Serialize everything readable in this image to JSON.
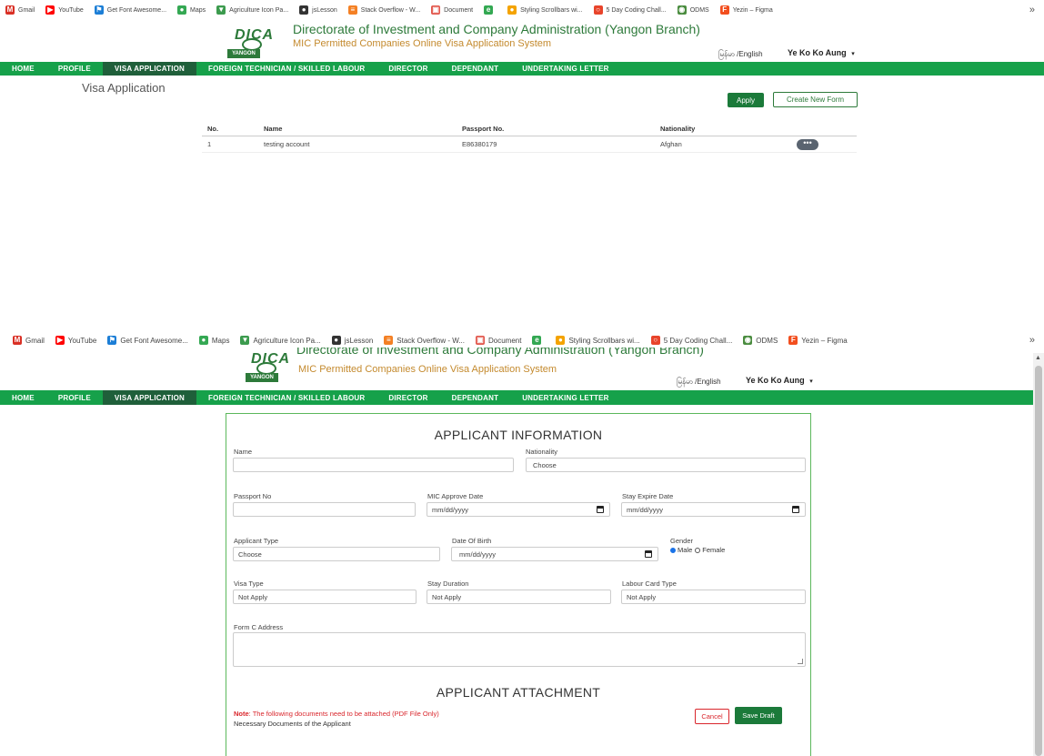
{
  "bookmarks": [
    {
      "label": "Gmail",
      "icon": "gmail-icon",
      "color": "#d93025",
      "glyph": "M"
    },
    {
      "label": "YouTube",
      "icon": "youtube-icon",
      "color": "#ff0000",
      "glyph": "▶"
    },
    {
      "label": "Get Font Awesome...",
      "icon": "font-awesome-icon",
      "color": "#1c7ed6",
      "glyph": "⚑"
    },
    {
      "label": "Maps",
      "icon": "maps-icon",
      "color": "#34a853",
      "glyph": "●"
    },
    {
      "label": "Agriculture Icon Pa...",
      "icon": "agriculture-icon",
      "color": "#3c9b4e",
      "glyph": "▼"
    },
    {
      "label": "jsLesson",
      "icon": "jslesson-icon",
      "color": "#333333",
      "glyph": "●"
    },
    {
      "label": "Stack Overflow - W...",
      "icon": "stackoverflow-icon",
      "color": "#f48024",
      "glyph": "≡"
    },
    {
      "label": "Document",
      "icon": "document-icon",
      "color": "#e2574c",
      "glyph": "▣"
    },
    {
      "label": "",
      "icon": "edge-icon",
      "color": "#33a852",
      "glyph": "e"
    },
    {
      "label": "Styling Scrollbars wi...",
      "icon": "styling-icon",
      "color": "#f4a300",
      "glyph": "●"
    },
    {
      "label": "5 Day Coding Chall...",
      "icon": "coding-icon",
      "color": "#e8442b",
      "glyph": "○"
    },
    {
      "label": "ODMS",
      "icon": "odms-icon",
      "color": "#4a8c3f",
      "glyph": "◉"
    },
    {
      "label": "Yezin – Figma",
      "icon": "figma-icon",
      "color": "#f24e1e",
      "glyph": "F"
    }
  ],
  "bookmarks_more": "»",
  "header": {
    "logo_text": "DICA",
    "logo_badge": "YANGON",
    "title": "Directorate of Investment and Company Administration (Yangon Branch)",
    "subtitle": "MIC Permitted Companies Online Visa Application System",
    "language": "မြန်မာ /English",
    "user": "Ye Ko Ko Aung",
    "user_caret": "▾"
  },
  "nav": [
    {
      "label": "HOME",
      "active": false
    },
    {
      "label": "PROFILE",
      "active": false
    },
    {
      "label": "VISA APPLICATION",
      "active": true
    },
    {
      "label": "FOREIGN TECHNICIAN / SKILLED LABOUR",
      "active": false
    },
    {
      "label": "DIRECTOR",
      "active": false
    },
    {
      "label": "DEPENDANT",
      "active": false
    },
    {
      "label": "UNDERTAKING LETTER",
      "active": false
    }
  ],
  "list_page": {
    "heading": "Visa Application",
    "apply_label": "Apply",
    "create_label": "Create New Form",
    "columns": [
      "No.",
      "Name",
      "Passport No.",
      "Nationality"
    ],
    "rows": [
      {
        "no": "1",
        "name": "testing account",
        "passport": "E86380179",
        "nationality": "Afghan",
        "action": "•••"
      }
    ]
  },
  "form": {
    "section1_title": "APPLICANT INFORMATION",
    "name_label": "Name",
    "name_value": "",
    "nationality_label": "Nationality",
    "nationality_value": "Choose",
    "passport_label": "Passport No",
    "passport_value": "",
    "mic_label": "MIC Approve Date",
    "mic_value": "mm/dd/yyyy",
    "stay_expire_label": "Stay Expire Date",
    "stay_expire_value": "mm/dd/yyyy",
    "applicant_type_label": "Applicant Type",
    "applicant_type_value": "Choose",
    "dob_label": "Date Of Birth",
    "dob_value": "mm/dd/yyyy",
    "gender_label": "Gender",
    "gender_male": "Male",
    "gender_female": "Female",
    "gender_selected": "Male",
    "visa_type_label": "Visa Type",
    "visa_type_value": "Not Apply",
    "stay_duration_label": "Stay Duration",
    "stay_duration_value": "Not Apply",
    "labour_card_label": "Labour Card Type",
    "labour_card_value": "Not Apply",
    "formc_label": "Form C Address",
    "section2_title": "APPLICANT ATTACHMENT",
    "note_prefix": "Note",
    "note_text": ": The following documents need to be attached (PDF File Only)",
    "necessary_docs": "Necessary Documents of the Applicant",
    "cancel_label": "Cancel",
    "save_label": "Save Draft"
  },
  "colors": {
    "nav_green": "#16a14a",
    "nav_active": "#1f5f3a",
    "brand_green": "#2d7a3a",
    "subtitle_gold": "#c48a2e",
    "button_green": "#1b7a3a",
    "cancel_red": "#d9262c"
  }
}
